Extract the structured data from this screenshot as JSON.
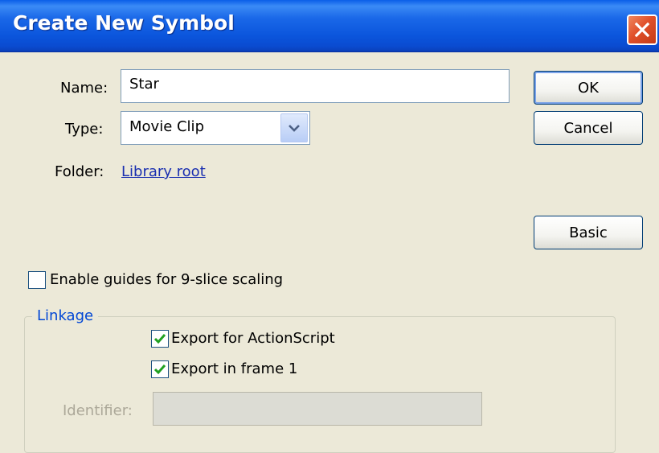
{
  "window": {
    "title": "Create New Symbol",
    "close_icon": "close-icon"
  },
  "form": {
    "name_label": "Name:",
    "name_value": "Star",
    "type_label": "Type:",
    "type_value": "Movie Clip",
    "folder_label": "Folder:",
    "folder_link": "Library root"
  },
  "buttons": {
    "ok": "OK",
    "cancel": "Cancel",
    "basic": "Basic"
  },
  "options": {
    "nine_slice_label": "Enable guides for 9-slice scaling",
    "nine_slice_checked": false
  },
  "linkage": {
    "legend": "Linkage",
    "export_actionscript_label": "Export for ActionScript",
    "export_actionscript_checked": true,
    "export_frame1_label": "Export in frame 1",
    "export_frame1_checked": true,
    "identifier_label": "Identifier:",
    "identifier_value": ""
  },
  "colors": {
    "titlebar": "#0a55dc",
    "dialog_bg": "#ece9d8",
    "link": "#1a2fb0",
    "group_legend": "#0046d5",
    "checkmark": "#21a121",
    "close_red": "#e0502a"
  }
}
